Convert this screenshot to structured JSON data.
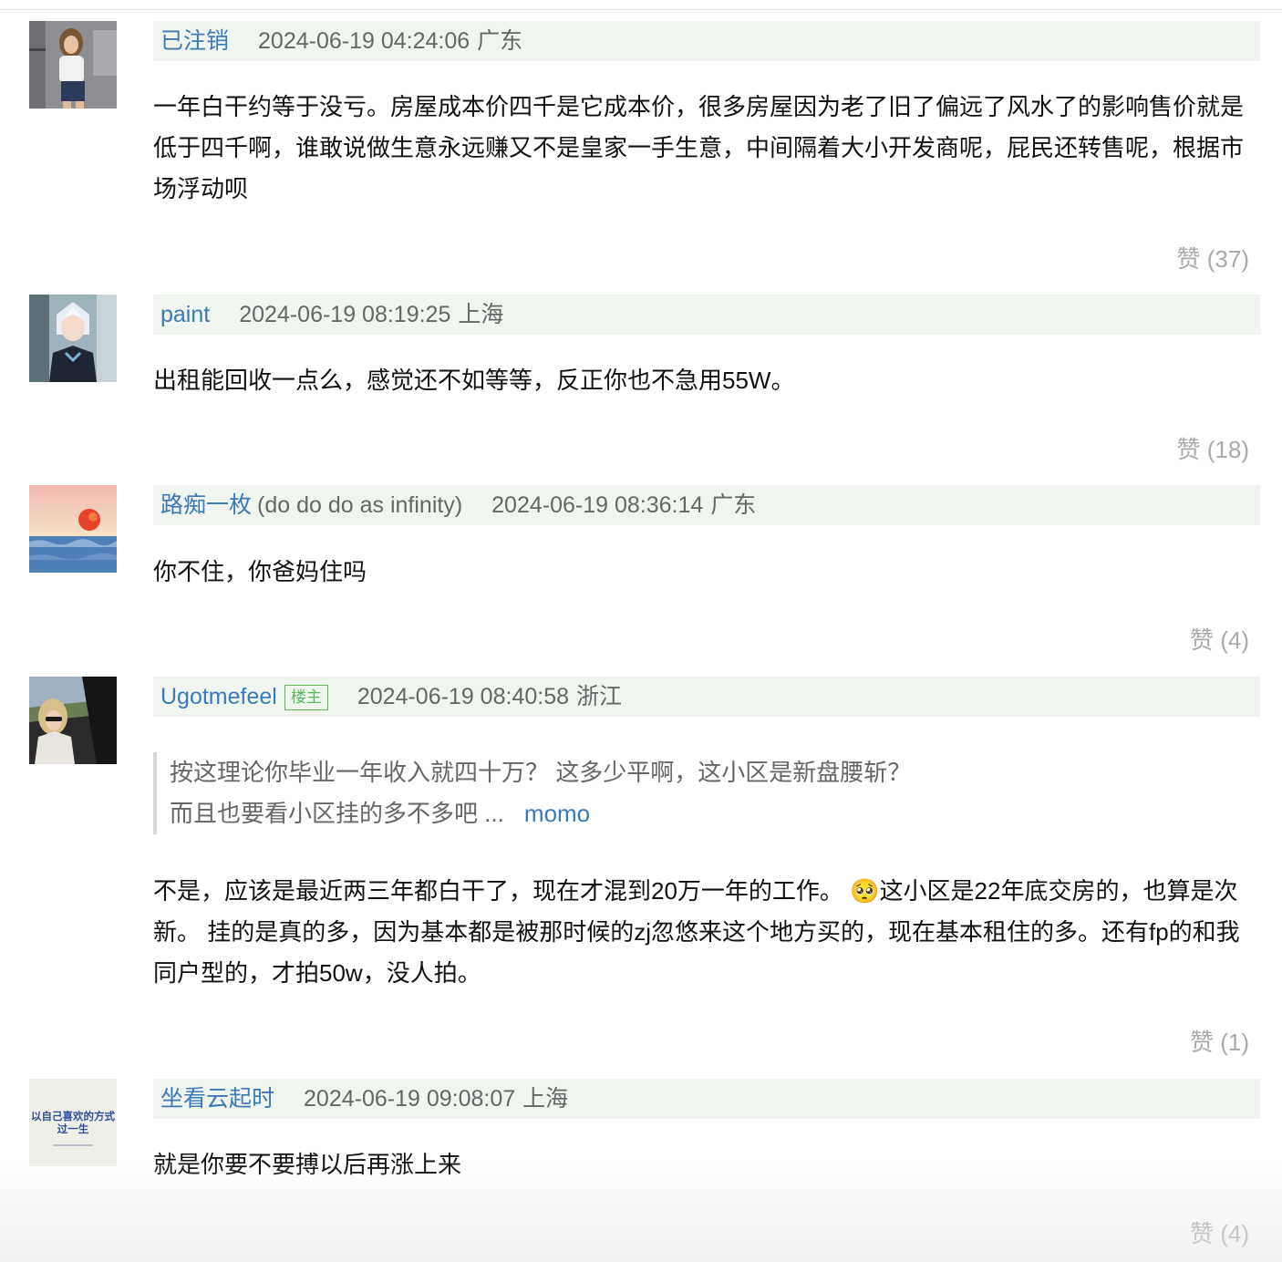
{
  "comments": [
    {
      "author": "已注销",
      "time": "2024-06-19 04:24:06",
      "location": "广东",
      "text": "一年白干约等于没亏。房屋成本价四千是它成本价，很多房屋因为老了旧了偏远了风水了的影响售价就是低于四千啊，谁敢说做生意永远赚又不是皇家一手生意，中间隔着大小开发商呢，屁民还转售呢，根据市场浮动呗",
      "like": "赞 (37)"
    },
    {
      "author": "paint",
      "time": "2024-06-19 08:19:25",
      "location": "上海",
      "text": "出租能回收一点么，感觉还不如等等，反正你也不急用55W。",
      "like": "赞 (18)"
    },
    {
      "author": "路痴一枚",
      "author_note": "(do do do as infinity)",
      "time": "2024-06-19 08:36:14",
      "location": "广东",
      "text": "你不住，你爸妈住吗",
      "like": "赞 (4)"
    },
    {
      "author": "Ugotmefeel",
      "badge": "楼主",
      "time": "2024-06-19 08:40:58",
      "location": "浙江",
      "quote": {
        "text": "按这理论你毕业一年收入就四十万？ 这多少平啊，这小区是新盘腰斩？而且也要看小区挂的多不多吧 ...",
        "author": "momo"
      },
      "text_a": "不是，应该是最近两三年都白干了，现在才混到20万一年的工作。",
      "emoji": "🥺",
      "text_b": "这小区是22年底交房的，也算是次新。 挂的是真的多，因为基本都是被那时候的zj忽悠来这个地方买的，现在基本租住的多。还有fp的和我同户型的，才拍50w，没人拍。",
      "like": "赞 (1)"
    },
    {
      "author": "坐看云起时",
      "time": "2024-06-19 09:08:07",
      "location": "上海",
      "avatar_text_1": "以自己喜欢的方式",
      "avatar_text_2": "过一生",
      "text": "就是你要不要搏以后再涨上来",
      "like": "赞 (4)"
    }
  ]
}
